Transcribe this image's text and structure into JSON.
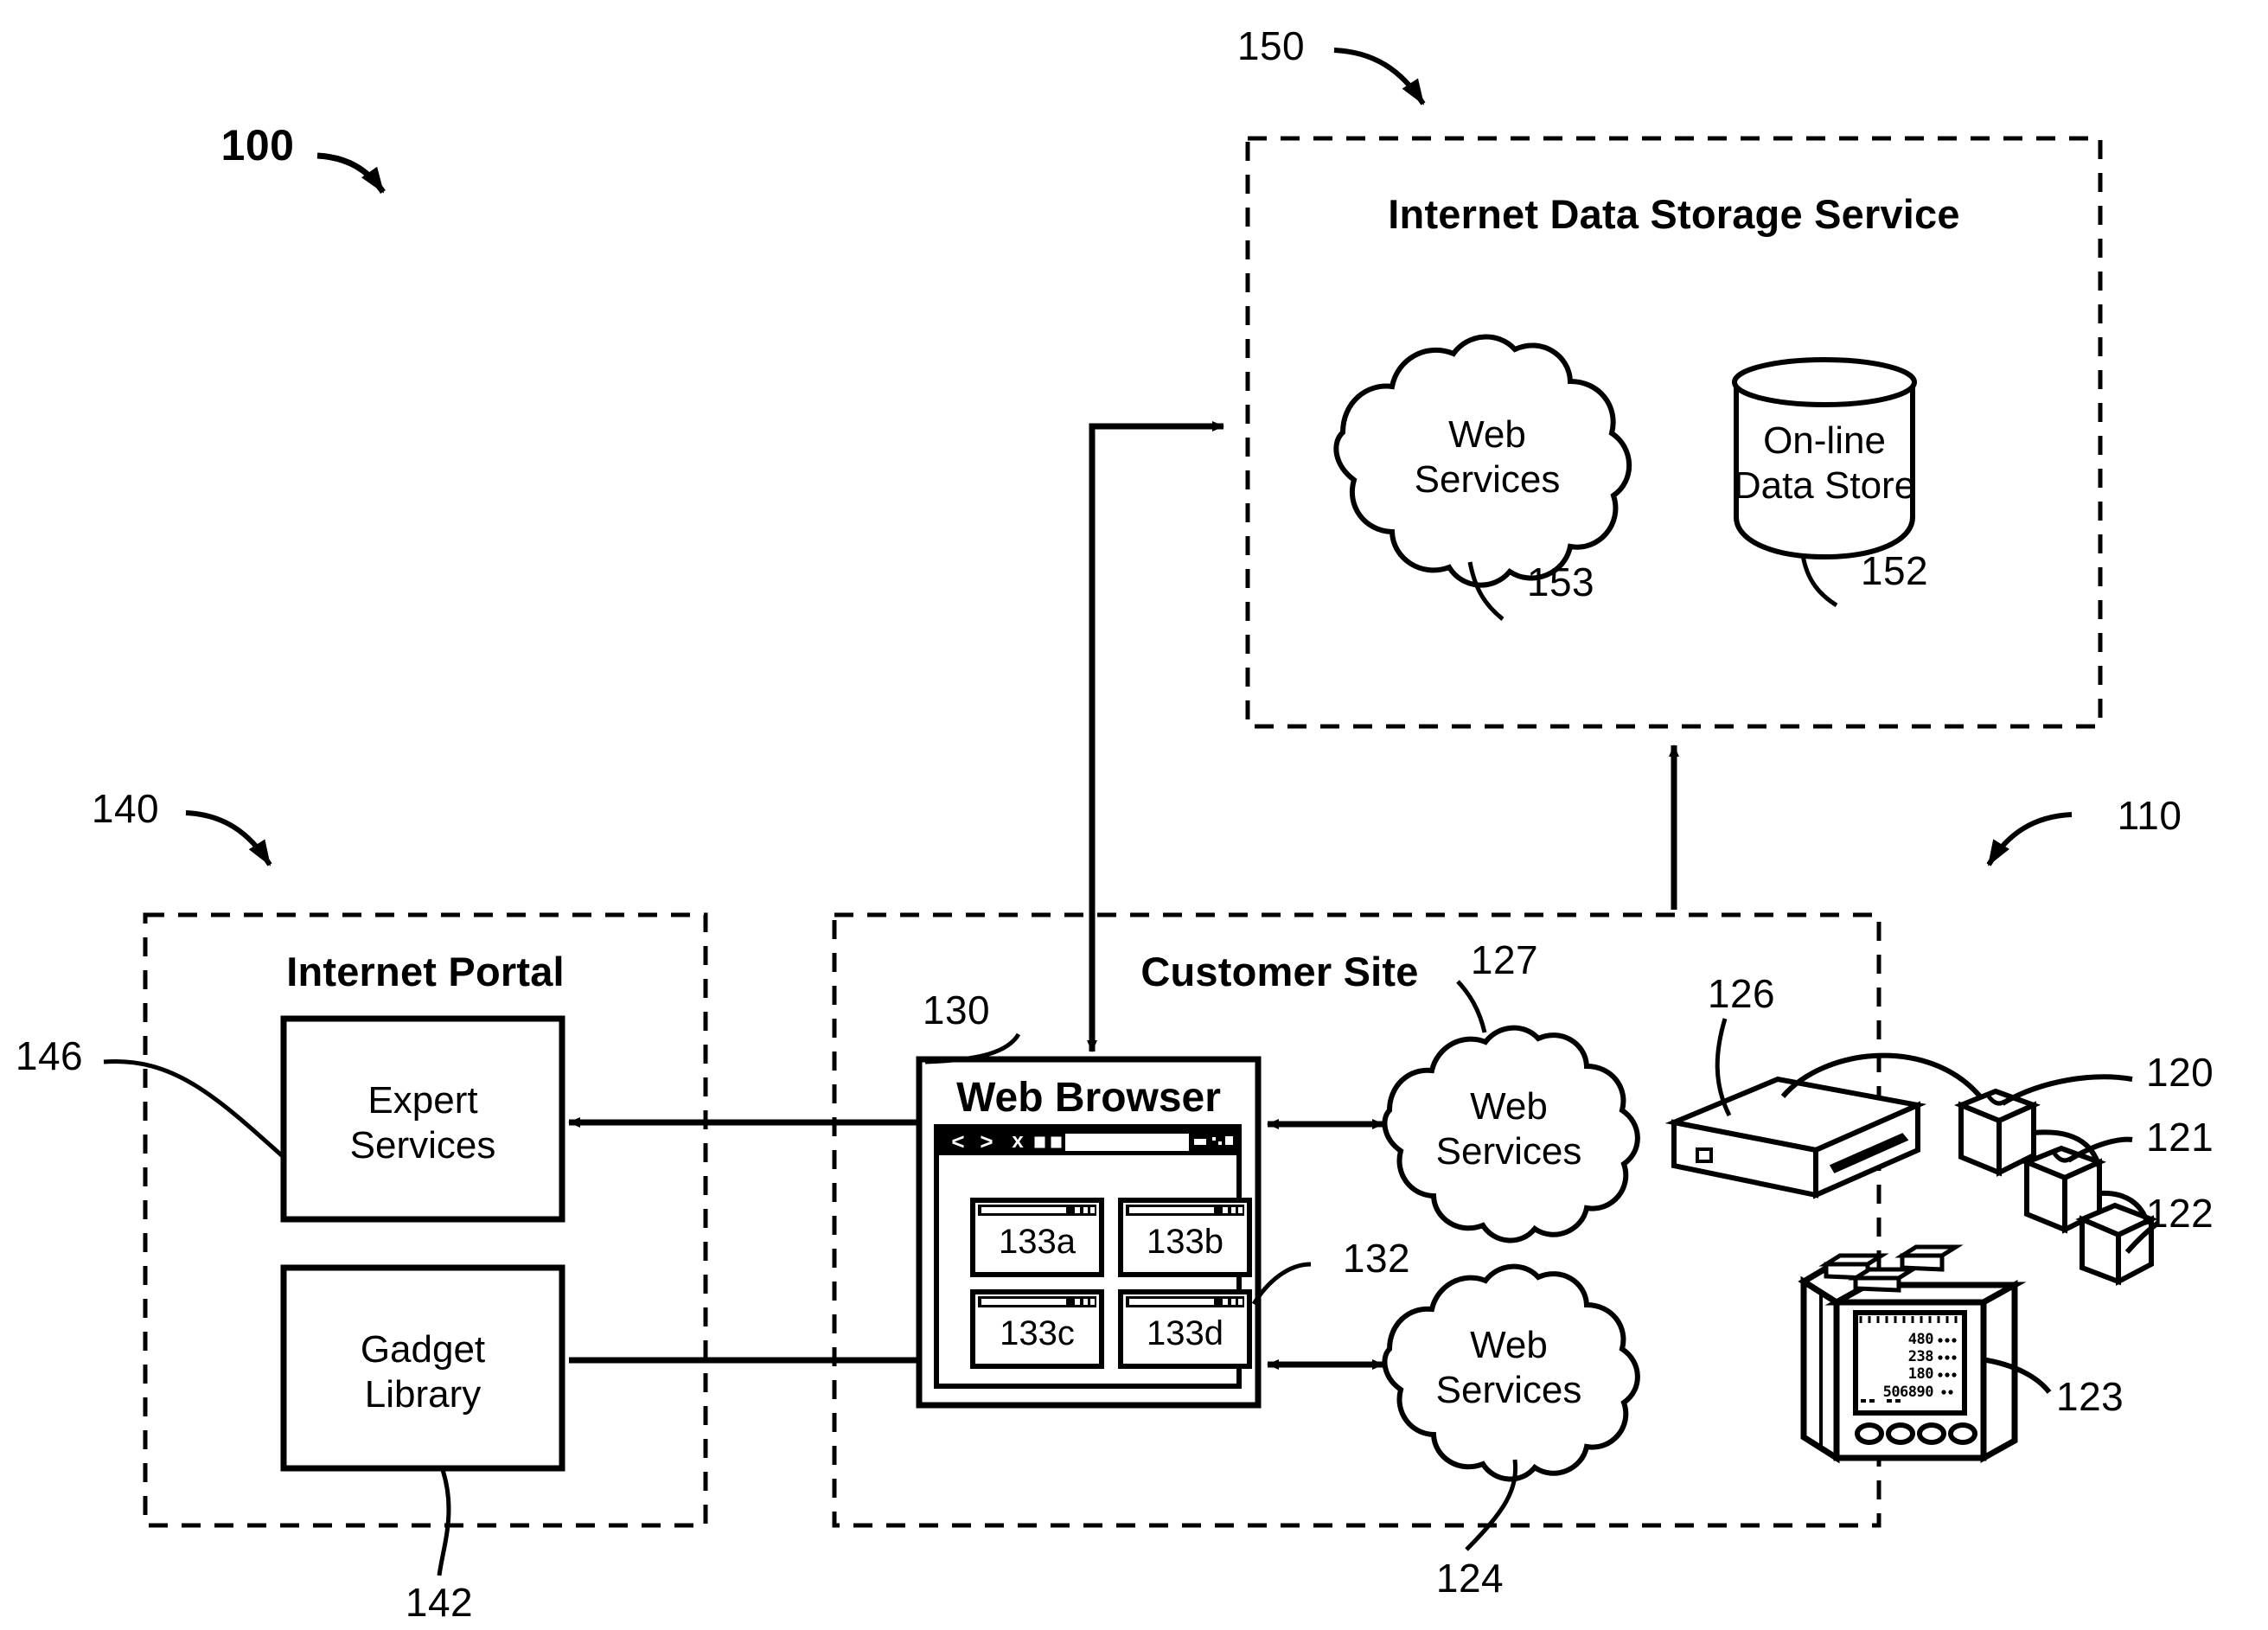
{
  "figure": {
    "overall_ref": "100",
    "zones": [
      {
        "id": "internet_data_storage_service",
        "title": "Internet Data Storage Service",
        "ref": "150"
      },
      {
        "id": "internet_portal",
        "title": "Internet Portal",
        "ref": "140"
      },
      {
        "id": "customer_site",
        "title": "Customer Site",
        "ref": "110"
      }
    ]
  },
  "storage_service": {
    "title": "Internet Data Storage Service",
    "ref": "150",
    "web_services": {
      "label": "Web\nServices",
      "line1": "Web",
      "line2": "Services",
      "ref": "153"
    },
    "data_store": {
      "label": "On-line\nData Store",
      "line1": "On-line",
      "line2": "Data Store",
      "ref": "152"
    }
  },
  "portal": {
    "title": "Internet Portal",
    "ref": "140",
    "expert_services": {
      "line1": "Expert",
      "line2": "Services",
      "ref": "146"
    },
    "gadget_library": {
      "line1": "Gadget",
      "line2": "Library",
      "ref": "142"
    }
  },
  "customer_site": {
    "title": "Customer Site",
    "ref": "110",
    "browser": {
      "title": "Web Browser",
      "ref": "130",
      "toolbar": {
        "back_icon": "<",
        "forward_icon": ">",
        "stop_icon": "x",
        "home_icon": "home-icon",
        "page_icon_1": "page-icon",
        "page_icon_2": "page-icon",
        "address_bar_value": ""
      },
      "gadgets_ref": "132",
      "gadgets": [
        {
          "label": "133a"
        },
        {
          "label": "133b"
        },
        {
          "label": "133c"
        },
        {
          "label": "133d"
        }
      ]
    },
    "web_services_upper": {
      "line1": "Web",
      "line2": "Services",
      "ref": "127"
    },
    "web_services_lower": {
      "line1": "Web",
      "line2": "Services",
      "ref": "124"
    },
    "devices": {
      "gateway": {
        "name": "gateway-device",
        "ref": "126"
      },
      "node_1": {
        "name": "sensor-node",
        "ref": "120"
      },
      "node_2": {
        "name": "sensor-node",
        "ref": "121"
      },
      "node_3": {
        "name": "sensor-node",
        "ref": "122"
      },
      "power_meter": {
        "name": "power-meter",
        "ref": "123",
        "display_rows": [
          "480",
          "238",
          "180",
          "506890"
        ]
      }
    }
  },
  "colors": {
    "ink": "#000000",
    "paper": "#ffffff"
  }
}
